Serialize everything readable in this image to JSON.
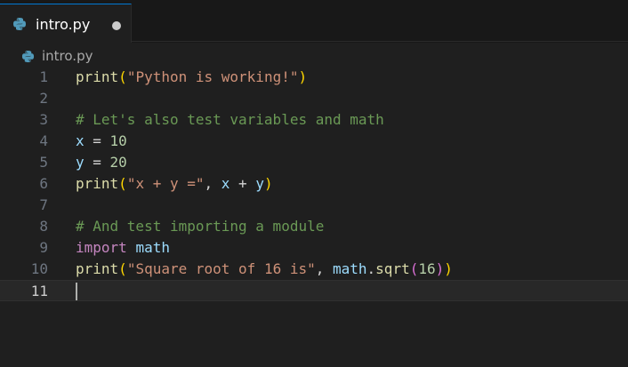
{
  "tab": {
    "label": "intro.py",
    "icon": "python-icon",
    "unsaved": true
  },
  "breadcrumb": {
    "label": "intro.py",
    "icon": "python-icon"
  },
  "editor": {
    "current_line": 11,
    "lines": [
      {
        "num": "1",
        "tokens": [
          {
            "t": "print",
            "c": "fn"
          },
          {
            "t": "(",
            "c": "b1"
          },
          {
            "t": "\"Python is working!\"",
            "c": "str"
          },
          {
            "t": ")",
            "c": "b1"
          }
        ]
      },
      {
        "num": "2",
        "tokens": []
      },
      {
        "num": "3",
        "tokens": [
          {
            "t": "# Let's also test variables and math",
            "c": "cm"
          }
        ]
      },
      {
        "num": "4",
        "tokens": [
          {
            "t": "x",
            "c": "var"
          },
          {
            "t": " = ",
            "c": "op"
          },
          {
            "t": "10",
            "c": "num"
          }
        ]
      },
      {
        "num": "5",
        "tokens": [
          {
            "t": "y",
            "c": "var"
          },
          {
            "t": " = ",
            "c": "op"
          },
          {
            "t": "20",
            "c": "num"
          }
        ]
      },
      {
        "num": "6",
        "tokens": [
          {
            "t": "print",
            "c": "fn"
          },
          {
            "t": "(",
            "c": "b1"
          },
          {
            "t": "\"x + y =\"",
            "c": "str"
          },
          {
            "t": ", ",
            "c": "op"
          },
          {
            "t": "x",
            "c": "var"
          },
          {
            "t": " + ",
            "c": "op"
          },
          {
            "t": "y",
            "c": "var"
          },
          {
            "t": ")",
            "c": "b1"
          }
        ]
      },
      {
        "num": "7",
        "tokens": []
      },
      {
        "num": "8",
        "tokens": [
          {
            "t": "# And test importing a module",
            "c": "cm"
          }
        ]
      },
      {
        "num": "9",
        "tokens": [
          {
            "t": "import",
            "c": "kw"
          },
          {
            "t": " ",
            "c": "op"
          },
          {
            "t": "math",
            "c": "var"
          }
        ]
      },
      {
        "num": "10",
        "tokens": [
          {
            "t": "print",
            "c": "fn"
          },
          {
            "t": "(",
            "c": "b1"
          },
          {
            "t": "\"Square root of 16 is\"",
            "c": "str"
          },
          {
            "t": ", ",
            "c": "op"
          },
          {
            "t": "math",
            "c": "var"
          },
          {
            "t": ".",
            "c": "op"
          },
          {
            "t": "sqrt",
            "c": "fn"
          },
          {
            "t": "(",
            "c": "b2"
          },
          {
            "t": "16",
            "c": "num"
          },
          {
            "t": ")",
            "c": "b2"
          },
          {
            "t": ")",
            "c": "b1"
          }
        ]
      },
      {
        "num": "11",
        "tokens": []
      }
    ]
  }
}
